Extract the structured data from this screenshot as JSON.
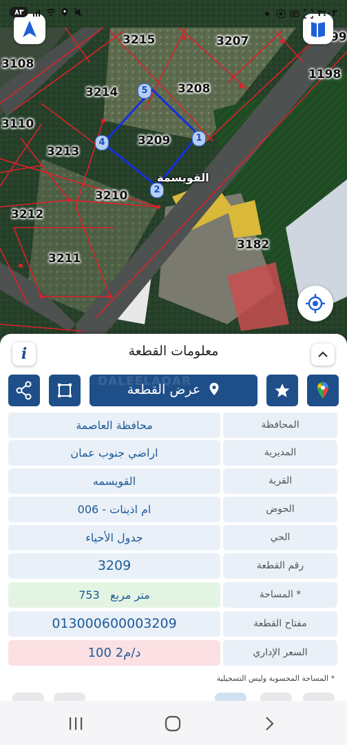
{
  "status_bar": {
    "time": "٣:٠٣",
    "battery": "٨٣"
  },
  "map": {
    "parcels": [
      {
        "id": "p3215",
        "label": "3215"
      },
      {
        "id": "p3207",
        "label": "3207"
      },
      {
        "id": "p3108",
        "label": "3108"
      },
      {
        "id": "p1198",
        "label": "1198"
      },
      {
        "id": "p99",
        "label": "99"
      },
      {
        "id": "p3214",
        "label": "3214"
      },
      {
        "id": "p3208",
        "label": "3208"
      },
      {
        "id": "p3110",
        "label": "3110"
      },
      {
        "id": "p3209",
        "label": "3209"
      },
      {
        "id": "p3213",
        "label": "3213"
      },
      {
        "id": "p3210",
        "label": "3210"
      },
      {
        "id": "p3212",
        "label": "3212"
      },
      {
        "id": "p3182",
        "label": "3182"
      },
      {
        "id": "p3211",
        "label": "3211"
      }
    ],
    "vertices": [
      "1",
      "2",
      "4",
      "5"
    ],
    "street_label": "القويسمة",
    "colors": {
      "parcel_lines": "#e0202a",
      "selection": "#1530e0"
    }
  },
  "sheet": {
    "title": "معلومات القطعة",
    "show_parcel_label": "عرض القطعة",
    "watermark": "DALEELAQAR",
    "rows": [
      {
        "key": "المحافظة",
        "value": "محافظة العاصمة",
        "bg": "#e9f0f8"
      },
      {
        "key": "المديرية",
        "value": "اراضي جنوب عمان",
        "bg": "#e9f0f8"
      },
      {
        "key": "القرية",
        "value": "القويسمه",
        "bg": "#e9f0f8"
      },
      {
        "key": "الحوض",
        "value": "ام اذينات - 006",
        "bg": "#e9f0f8"
      },
      {
        "key": "الحي",
        "value": "جدول الأحياء",
        "bg": "#e9f0f8"
      },
      {
        "key": "رقم القطعة",
        "value": "3209",
        "bg": "#e9f0f8"
      },
      {
        "key": "المساحة *",
        "value": "753   متر مربع",
        "bg": "#e3f4e3"
      },
      {
        "key": "مفتاح القطعة",
        "value": "013000600003209",
        "bg": "#e9f0f8"
      },
      {
        "key": "السعر الإداري",
        "value": "100 د/م2",
        "bg": "#fbe1e4"
      }
    ],
    "footnote": "* المساحة المحسوبة وليس التسجيلية"
  },
  "colors": {
    "primary": "#1f4f89",
    "value_text": "#1e5a96"
  }
}
